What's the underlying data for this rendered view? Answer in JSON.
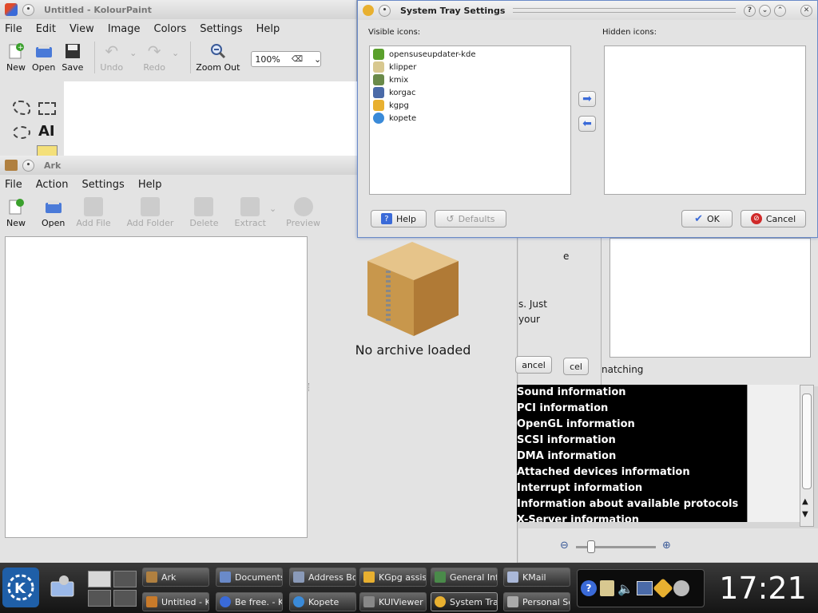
{
  "kolourpaint": {
    "title": "Untitled - KolourPaint",
    "menu": [
      "File",
      "Edit",
      "View",
      "Image",
      "Colors",
      "Settings",
      "Help"
    ],
    "toolbar": {
      "new": "New",
      "open": "Open",
      "save": "Save",
      "undo": "Undo",
      "redo": "Redo",
      "zoom_out": "Zoom Out"
    },
    "zoom_value": "100%"
  },
  "ark": {
    "title": "Ark",
    "menu": [
      "File",
      "Action",
      "Settings",
      "Help"
    ],
    "toolbar": {
      "new": "New",
      "open": "Open",
      "add_file": "Add File",
      "add_folder": "Add Folder",
      "delete": "Delete",
      "extract": "Extract",
      "preview": "Preview"
    },
    "empty_message": "No archive loaded"
  },
  "background_fragments": {
    "partial_e": "e",
    "partial_just": "s. Just",
    "partial_your": "your",
    "cancel1": "ancel",
    "cancel2": "cel",
    "matching": "natching"
  },
  "kinfo_list": [
    "Sound information",
    "PCI information",
    "OpenGL information",
    "SCSI information",
    "DMA information",
    "Attached devices information",
    "Interrupt information",
    "Information about available protocols",
    "X-Server information"
  ],
  "systray": {
    "title": "System Tray Settings",
    "visible_label": "Visible icons:",
    "hidden_label": "Hidden icons:",
    "visible_icons": [
      {
        "name": "opensuseupdater-kde",
        "color": "#5aa02c"
      },
      {
        "name": "klipper",
        "color": "#d8c890"
      },
      {
        "name": "kmix",
        "color": "#6a8a4a"
      },
      {
        "name": "korgac",
        "color": "#4a6aa8"
      },
      {
        "name": "kgpg",
        "color": "#e8b030"
      },
      {
        "name": "kopete",
        "color": "#3a8ad8"
      }
    ],
    "help": "Help",
    "defaults": "Defaults",
    "ok": "OK",
    "cancel": "Cancel"
  },
  "taskbar": {
    "row1": [
      {
        "label": "Ark",
        "color": "#b08040"
      },
      {
        "label": "Documents",
        "color": "#6a8ac8"
      },
      {
        "label": "Address Bo",
        "color": "#8a9ab8"
      },
      {
        "label": "KGpg assist",
        "color": "#e8b030"
      },
      {
        "label": "General Inf",
        "color": "#4a8a4a"
      },
      {
        "label": "KMail",
        "color": "#aab8d8"
      }
    ],
    "row2": [
      {
        "label": "Untitled - K",
        "color": "#c87a2a"
      },
      {
        "label": "Be free. - K",
        "color": "#3a6ad8"
      },
      {
        "label": "Kopete",
        "color": "#3a8ad8"
      },
      {
        "label": "KUIViewer",
        "color": "#888"
      },
      {
        "label": "System Tra",
        "color": "#e8b030"
      },
      {
        "label": "Personal Se",
        "color": "#aaa"
      }
    ],
    "clock": "17:21"
  },
  "colors": {
    "kde_blue": "#1f5fa8",
    "taskbar_dark": "#1e1e1e"
  }
}
